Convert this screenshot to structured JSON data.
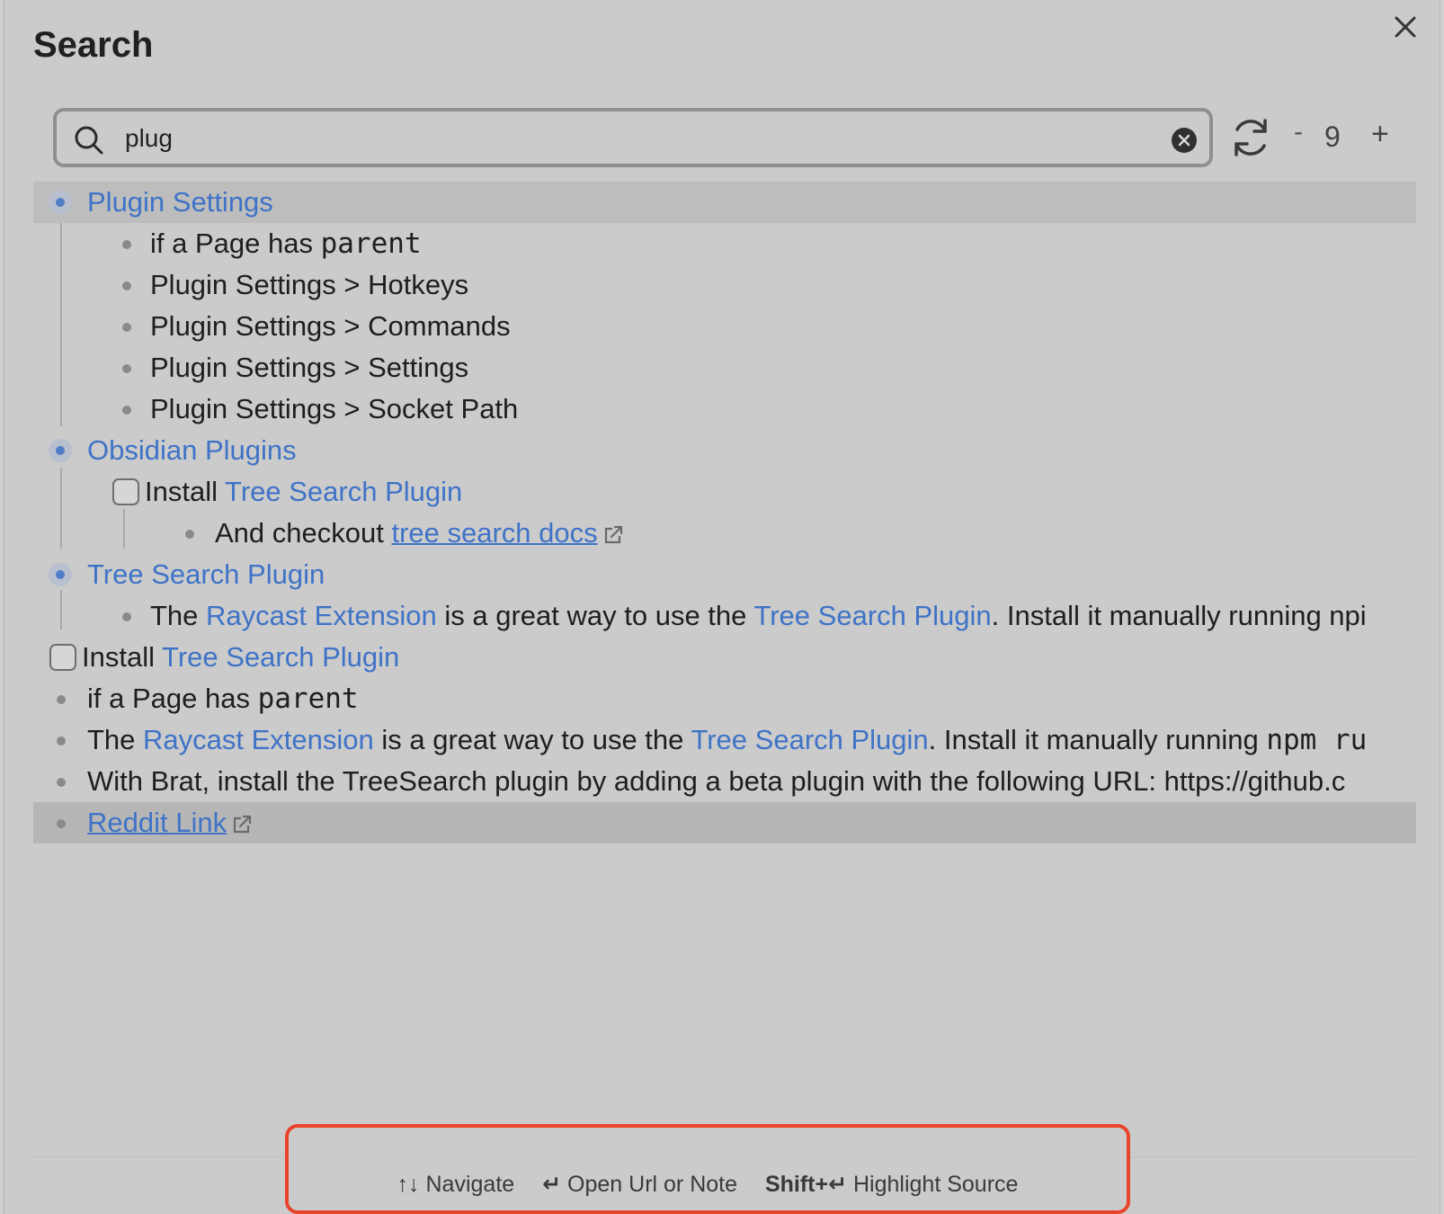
{
  "title": "Search",
  "search": {
    "value": "plug",
    "placeholder": ""
  },
  "depth": {
    "minus": "-",
    "value": "9",
    "plus": "+"
  },
  "results": {
    "r1": {
      "text": "Plugin Settings"
    },
    "r2": {
      "pre": "if a Page has ",
      "code": "parent"
    },
    "r3": {
      "text": "Plugin Settings > Hotkeys"
    },
    "r4": {
      "text": "Plugin Settings > Commands"
    },
    "r5": {
      "text": "Plugin Settings > Settings"
    },
    "r6": {
      "text": "Plugin Settings > Socket Path"
    },
    "r7": {
      "text": "Obsidian Plugins"
    },
    "r8": {
      "pre": "Install ",
      "link": "Tree Search Plugin"
    },
    "r9": {
      "pre": "And checkout ",
      "link": "tree search docs"
    },
    "r10": {
      "text": "Tree Search Plugin"
    },
    "r11": {
      "p1": "The ",
      "l1": "Raycast Extension",
      "p2": " is a great way to use the ",
      "l2": "Tree Search Plugin",
      "p3": ". Install it manually running npi"
    },
    "r12": {
      "pre": "Install ",
      "link": "Tree Search Plugin"
    },
    "r13": {
      "pre": "if a Page has ",
      "code": "parent"
    },
    "r14": {
      "p1": "The ",
      "l1": "Raycast Extension",
      "p2": " is a great way to use the ",
      "l2": "Tree Search Plugin",
      "p3": ". Install it manually running ",
      "code": "npm ru"
    },
    "r15": {
      "text": "With Brat, install the TreeSearch plugin by adding a beta plugin with the following URL: https://github.c"
    },
    "r16": {
      "link": "Reddit Link"
    }
  },
  "footer": {
    "navigate_keys": "↑↓",
    "navigate_label": "Navigate",
    "open_keys": "↵",
    "open_label": "Open Url or Note",
    "highlight_keys": "Shift+↵",
    "highlight_label": "Highlight Source"
  },
  "colors": {
    "link": "#3f73c7",
    "footer_border": "#e8432b"
  },
  "icons": [
    "close-icon",
    "search-icon",
    "clear-icon",
    "refresh-icon",
    "external-link-icon"
  ]
}
